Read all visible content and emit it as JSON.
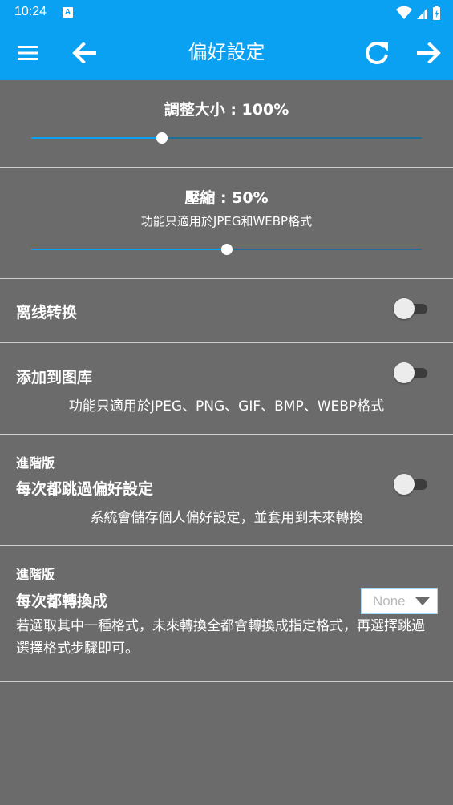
{
  "status_bar": {
    "time": "10:24",
    "notification_badge": "A",
    "icons": [
      "wifi-icon",
      "signal-icon",
      "battery-icon"
    ]
  },
  "app_bar": {
    "title": "偏好設定",
    "icons": [
      "menu-icon",
      "back-arrow-icon",
      "refresh-icon",
      "forward-arrow-icon"
    ],
    "color": "#0aa1f2"
  },
  "resize": {
    "title": "調整大小 : 100%",
    "slider_fraction": 0.335
  },
  "compression": {
    "title": "壓縮 : 50%",
    "subtitle": "功能只適用於JPEG和WEBP格式",
    "slider_fraction": 0.5
  },
  "offline_convert": {
    "label": "离线转换",
    "enabled": false
  },
  "add_to_gallery": {
    "label": "添加到图库",
    "description": "功能只適用於JPEG、PNG、GIF、BMP、WEBP格式",
    "enabled": false
  },
  "skip_preferences": {
    "tag": "進階版",
    "label": "每次都跳過偏好設定",
    "description": "系統會儲存個人偏好設定，並套用到未來轉換",
    "enabled": false
  },
  "always_convert": {
    "tag": "進階版",
    "label": "每次都轉換成",
    "selected": "None",
    "description": "若選取其中一種格式，未來轉換全都會轉換成指定格式，再選擇跳過選擇格式步驟即可。"
  }
}
